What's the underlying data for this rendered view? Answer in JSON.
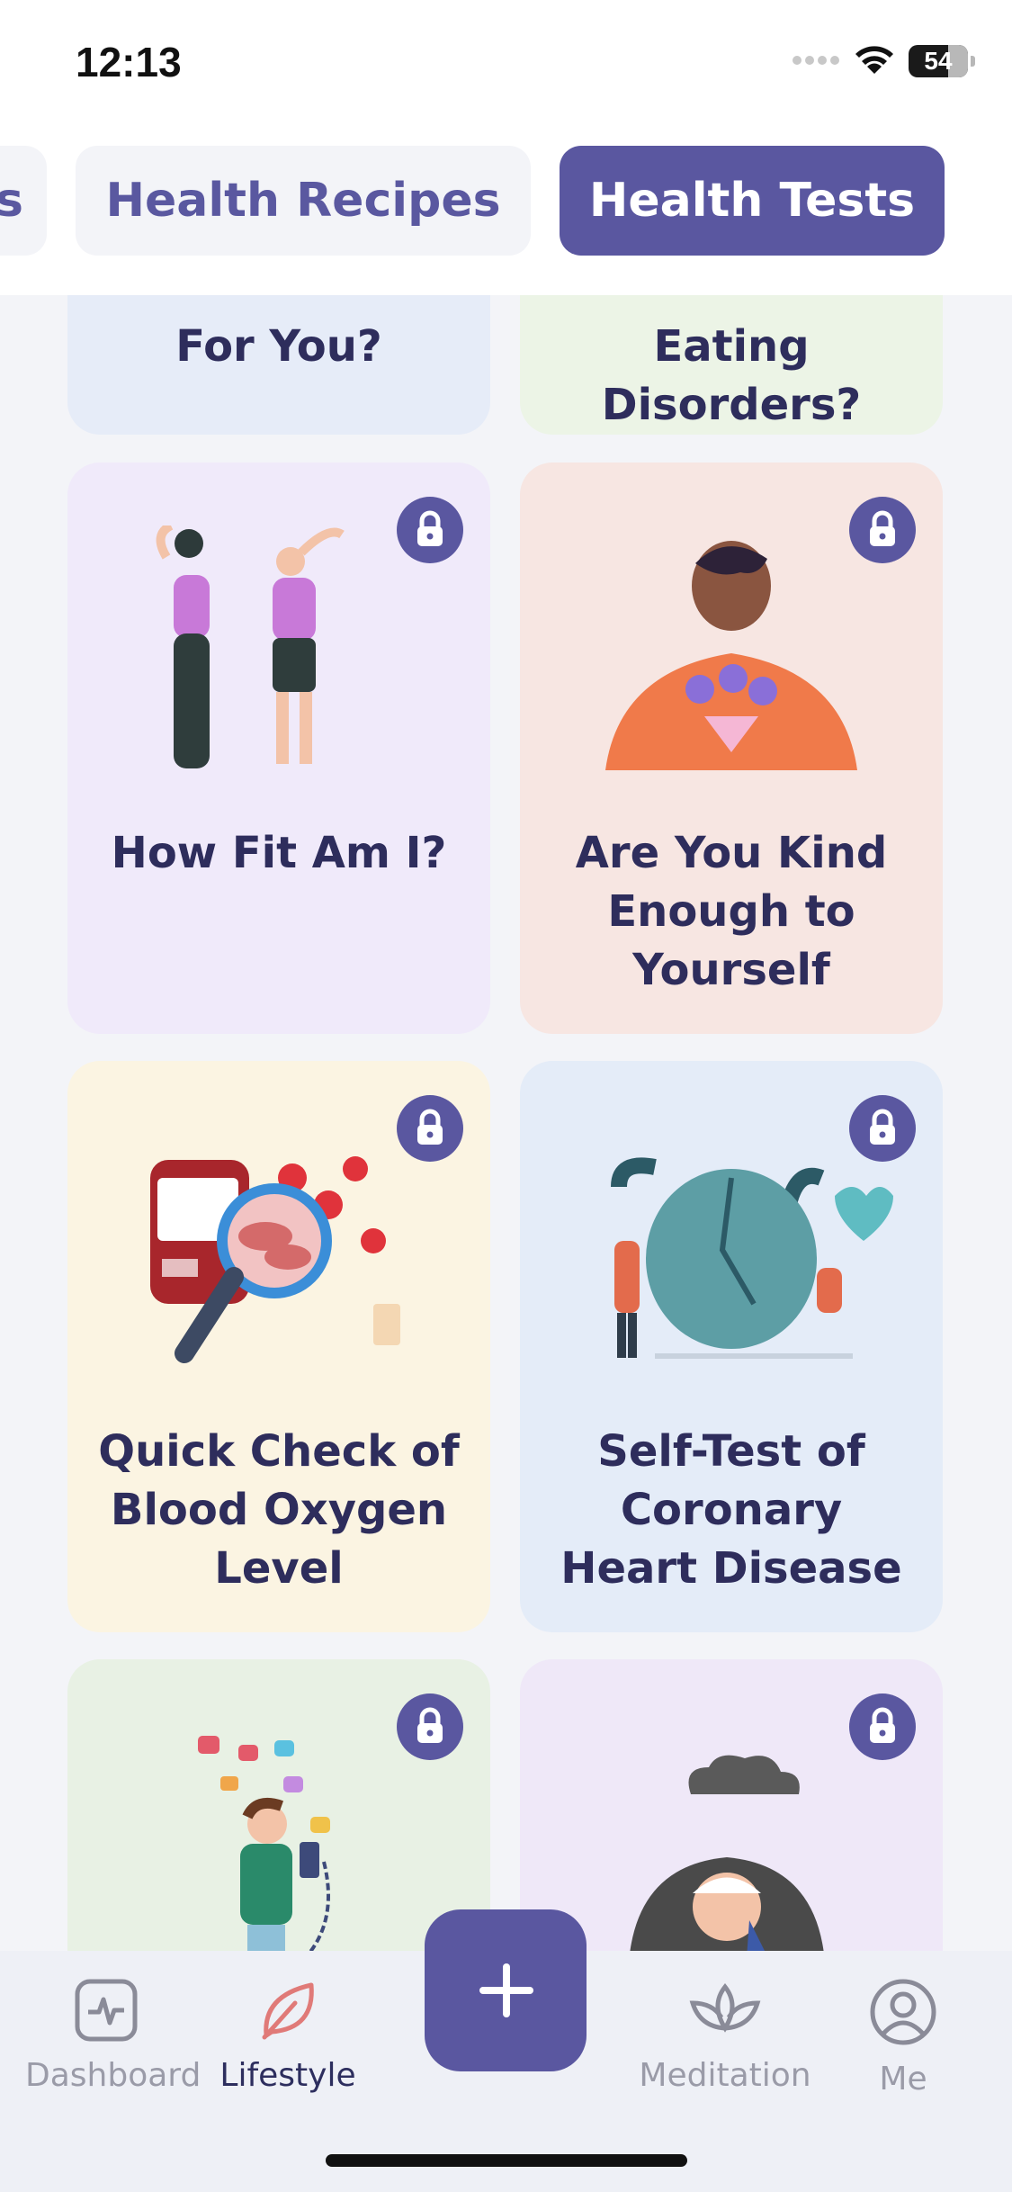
{
  "status_bar": {
    "time": "12:13",
    "battery": "54"
  },
  "tabs": [
    {
      "label": "s"
    },
    {
      "label": "Health Recipes"
    },
    {
      "label": "Health Tests"
    }
  ],
  "cards": [
    {
      "title_line1": "For You?"
    },
    {
      "title_line1": "Eating",
      "title_line2": "Disorders?"
    },
    {
      "title_line1": "How Fit Am I?"
    },
    {
      "title_line1": "Are You Kind",
      "title_line2": "Enough to",
      "title_line3": "Yourself"
    },
    {
      "title_line1": "Quick Check of",
      "title_line2": "Blood Oxygen",
      "title_line3": "Level"
    },
    {
      "title_line1": "Self-Test of",
      "title_line2": "Coronary",
      "title_line3": "Heart Disease"
    }
  ],
  "bottom_nav": [
    {
      "label": "Dashboard",
      "icon": "dashboard-icon"
    },
    {
      "label": "Lifestyle",
      "icon": "leaf-icon"
    },
    {
      "label": "Meditation",
      "icon": "lotus-icon"
    },
    {
      "label": "Me",
      "icon": "profile-icon"
    }
  ],
  "colors": {
    "accent": "#5a57a0",
    "title_text": "#2e2d5c",
    "card_blue": "#e6ecf8",
    "card_green": "#ecf4e6",
    "card_lavender": "#f0eafa",
    "card_peach": "#f7e6e2",
    "card_cream": "#fbf4e2",
    "card_sky": "#e4ecf8",
    "card_mint": "#e8f1e4",
    "card_violet": "#efe8f8"
  }
}
